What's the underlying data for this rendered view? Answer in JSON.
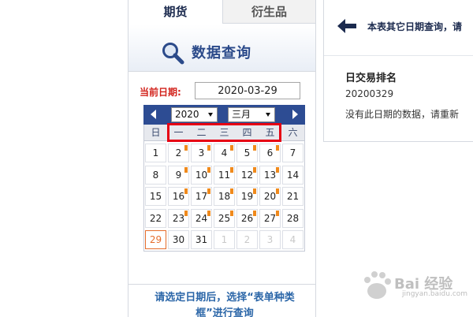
{
  "tabs": [
    "期货",
    "衍生品"
  ],
  "query": {
    "title": "数据查询",
    "icon": "magnifier-icon"
  },
  "date_field": {
    "label": "当前日期:",
    "value": "2020-03-29"
  },
  "calendar": {
    "year": "2020",
    "month": "三月",
    "weekdays": [
      "日",
      "一",
      "二",
      "三",
      "四",
      "五",
      "六"
    ],
    "weeks": [
      [
        {
          "d": "1"
        },
        {
          "d": "2",
          "m": true
        },
        {
          "d": "3",
          "m": true
        },
        {
          "d": "4",
          "m": true
        },
        {
          "d": "5",
          "m": true
        },
        {
          "d": "6",
          "m": true
        },
        {
          "d": "7"
        }
      ],
      [
        {
          "d": "8"
        },
        {
          "d": "9",
          "m": true
        },
        {
          "d": "10",
          "m": true
        },
        {
          "d": "11",
          "m": true
        },
        {
          "d": "12",
          "m": true
        },
        {
          "d": "13",
          "m": true
        },
        {
          "d": "14"
        }
      ],
      [
        {
          "d": "15"
        },
        {
          "d": "16",
          "m": true
        },
        {
          "d": "17",
          "m": true
        },
        {
          "d": "18",
          "m": true
        },
        {
          "d": "19",
          "m": true
        },
        {
          "d": "20",
          "m": true
        },
        {
          "d": "21"
        }
      ],
      [
        {
          "d": "22"
        },
        {
          "d": "23",
          "m": true
        },
        {
          "d": "24",
          "m": true
        },
        {
          "d": "25",
          "m": true
        },
        {
          "d": "26",
          "m": true
        },
        {
          "d": "27",
          "m": true
        },
        {
          "d": "28"
        }
      ],
      [
        {
          "d": "29",
          "today": true
        },
        {
          "d": "30"
        },
        {
          "d": "31"
        },
        {
          "d": "1",
          "o": true
        },
        {
          "d": "2",
          "o": true
        },
        {
          "d": "3",
          "o": true
        },
        {
          "d": "4",
          "o": true
        }
      ]
    ]
  },
  "hint": "请选定日期后，选择“表单种类框”进行查询",
  "right": {
    "title": "本表其它日期查询，请",
    "rank_label": "日交易排名",
    "date": "20200329",
    "message": "没有此日期的数据，请重新"
  },
  "watermark": {
    "text": "Bai 经验",
    "sub": "jingyan.baidu.com"
  },
  "colors": {
    "accent": "#2d4c93",
    "highlight": "#e60013",
    "mark": "#f08a1c",
    "label": "#d2231c"
  }
}
